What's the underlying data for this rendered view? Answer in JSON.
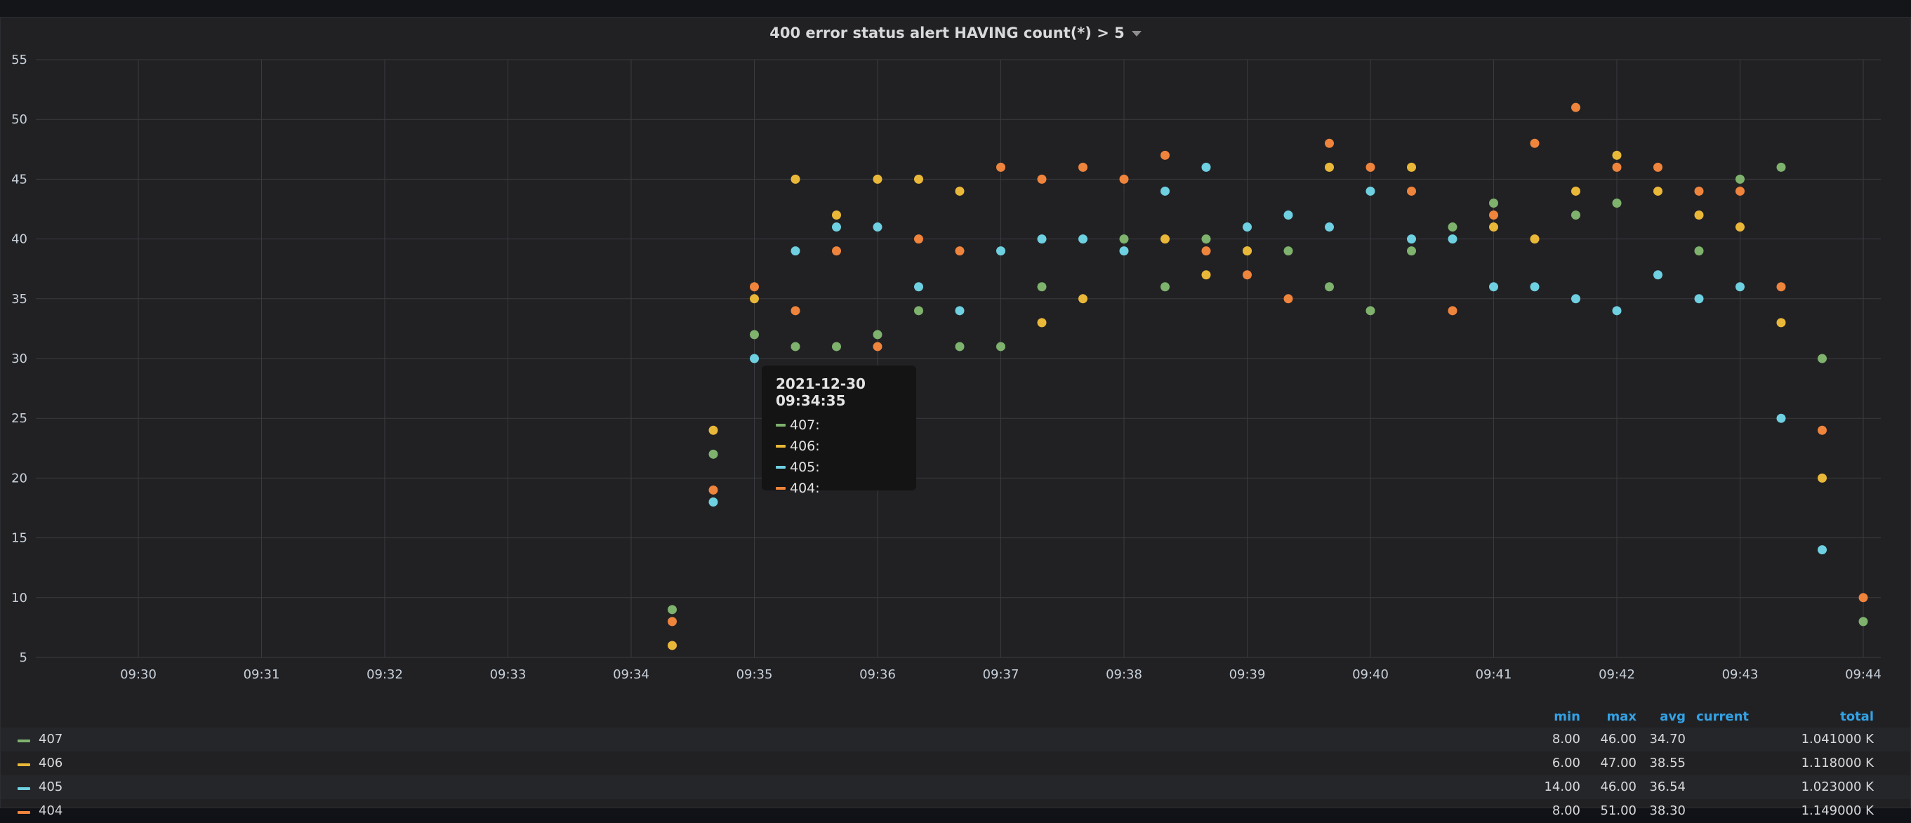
{
  "panel": {
    "title": "400 error status alert HAVING count(*) > 5"
  },
  "colors": {
    "407": "#7eb26d",
    "406": "#eab839",
    "405": "#6ed0e0",
    "404": "#ef843c"
  },
  "chart_data": {
    "type": "scatter",
    "title": "400 error status alert HAVING count(*) > 5",
    "ylim": [
      5,
      55
    ],
    "yticks": [
      "5",
      "10",
      "15",
      "20",
      "25",
      "30",
      "35",
      "40",
      "45",
      "50",
      "55"
    ],
    "xticks": [
      "09:30",
      "09:31",
      "09:32",
      "09:33",
      "09:34",
      "09:35",
      "09:36",
      "09:37",
      "09:38",
      "09:39",
      "09:40",
      "09:41",
      "09:42",
      "09:43",
      "09:44"
    ],
    "grid": true,
    "legend_placement": "bottom",
    "x": [
      "09:34:20",
      "09:34:40",
      "09:35:00",
      "09:35:20",
      "09:35:40",
      "09:36:00",
      "09:36:20",
      "09:36:40",
      "09:37:00",
      "09:37:20",
      "09:37:40",
      "09:38:00",
      "09:38:20",
      "09:38:40",
      "09:39:00",
      "09:39:20",
      "09:39:40",
      "09:40:00",
      "09:40:20",
      "09:40:40",
      "09:41:00",
      "09:41:20",
      "09:41:40",
      "09:42:00",
      "09:42:20",
      "09:42:40",
      "09:43:00",
      "09:43:20",
      "09:43:40",
      "09:44:00"
    ],
    "series": [
      {
        "name": "407",
        "color": "#7eb26d",
        "values": [
          9,
          22,
          32,
          31,
          31,
          32,
          34,
          31,
          31,
          36,
          null,
          40,
          36,
          40,
          39,
          39,
          36,
          34,
          39,
          41,
          43,
          null,
          42,
          43,
          null,
          39,
          45,
          46,
          30,
          8
        ]
      },
      {
        "name": "406",
        "color": "#eab839",
        "values": [
          6,
          24,
          35,
          45,
          42,
          45,
          45,
          44,
          null,
          33,
          35,
          null,
          40,
          37,
          39,
          null,
          46,
          null,
          46,
          null,
          41,
          40,
          44,
          47,
          44,
          42,
          41,
          33,
          20,
          null
        ]
      },
      {
        "name": "405",
        "color": "#6ed0e0",
        "values": [
          null,
          18,
          30,
          39,
          41,
          41,
          36,
          34,
          39,
          40,
          40,
          39,
          44,
          46,
          41,
          42,
          41,
          44,
          40,
          40,
          36,
          36,
          35,
          34,
          37,
          35,
          36,
          25,
          14,
          null
        ]
      },
      {
        "name": "404",
        "color": "#ef843c",
        "values": [
          8,
          19,
          36,
          34,
          39,
          31,
          40,
          39,
          46,
          45,
          46,
          45,
          47,
          39,
          37,
          35,
          48,
          46,
          44,
          34,
          42,
          48,
          51,
          46,
          46,
          44,
          44,
          36,
          24,
          10
        ]
      }
    ]
  },
  "tooltip": {
    "time": "2021-12-30 09:34:35",
    "rows": [
      {
        "label": "407:",
        "color": "#7eb26d"
      },
      {
        "label": "406:",
        "color": "#eab839"
      },
      {
        "label": "405:",
        "color": "#6ed0e0"
      },
      {
        "label": "404:",
        "color": "#ef843c"
      }
    ]
  },
  "legend": {
    "headers": {
      "min": "min",
      "max": "max",
      "avg": "avg",
      "current": "current",
      "total": "total"
    },
    "rows": [
      {
        "name": "407",
        "color": "#7eb26d",
        "min": "8.00",
        "max": "46.00",
        "avg": "34.70",
        "current": "",
        "total": "1.041000 K"
      },
      {
        "name": "406",
        "color": "#eab839",
        "min": "6.00",
        "max": "47.00",
        "avg": "38.55",
        "current": "",
        "total": "1.118000 K"
      },
      {
        "name": "405",
        "color": "#6ed0e0",
        "min": "14.00",
        "max": "46.00",
        "avg": "36.54",
        "current": "",
        "total": "1.023000 K"
      },
      {
        "name": "404",
        "color": "#ef843c",
        "min": "8.00",
        "max": "51.00",
        "avg": "38.30",
        "current": "",
        "total": "1.149000 K"
      }
    ]
  }
}
